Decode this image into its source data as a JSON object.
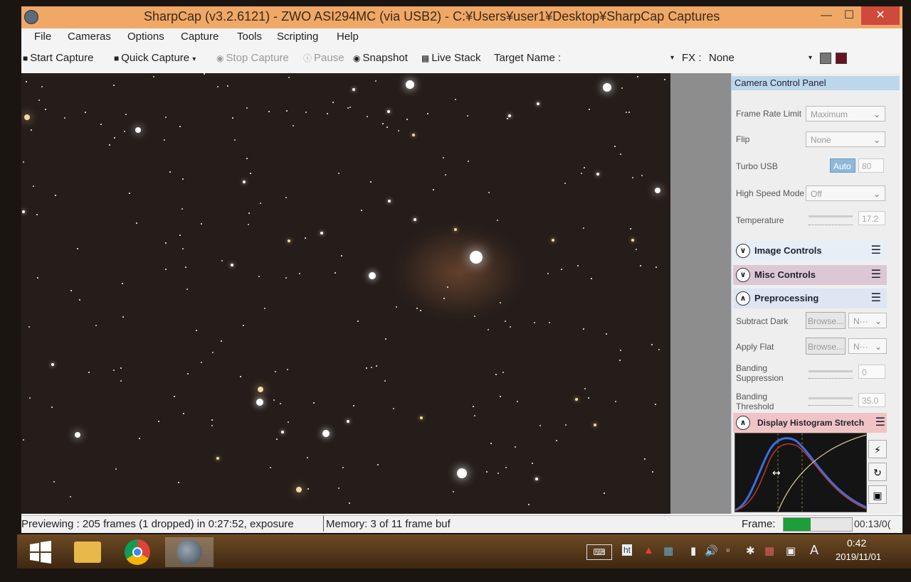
{
  "window": {
    "title": "SharpCap (v3.2.6121) - ZWO ASI294MC (via USB2) - C:¥Users¥user1¥Desktop¥SharpCap Captures",
    "min_label": "—",
    "max_label": "☐",
    "close_label": "✕"
  },
  "menu": [
    "File",
    "Cameras",
    "Options",
    "Capture",
    "Tools",
    "Scripting",
    "Help"
  ],
  "toolbar": {
    "start_capture": "Start Capture",
    "quick_capture": "Quick Capture",
    "stop_capture": "Stop Capture",
    "pause": "Pause",
    "snapshot": "Snapshot",
    "live_stack": "Live Stack",
    "target_name_label": "Target Name :",
    "fx_label": "FX :",
    "fx_value": "None"
  },
  "panel": {
    "title": "Camera Control Panel",
    "frame_rate_limit": {
      "label": "Frame Rate Limit",
      "value": "Maximum"
    },
    "flip": {
      "label": "Flip",
      "value": "None"
    },
    "turbo_usb": {
      "label": "Turbo USB",
      "auto": "Auto",
      "value": "80"
    },
    "high_speed_mode": {
      "label": "High Speed Mode",
      "value": "Off"
    },
    "temperature": {
      "label": "Temperature",
      "value": "17.2"
    },
    "sections": {
      "image_controls": "Image Controls",
      "misc_controls": "Misc Controls",
      "preprocessing": "Preprocessing",
      "histogram_stretch": "Display Histogram Stretch"
    },
    "subtract_dark": {
      "label": "Subtract Dark",
      "browse": "Browse...",
      "value": "N···"
    },
    "apply_flat": {
      "label": "Apply Flat",
      "browse": "Browse...",
      "value": "N···"
    },
    "banding_suppression": {
      "label": "Banding Suppression",
      "value": "0"
    },
    "banding_threshold": {
      "label": "Banding Threshold",
      "value": "35.0"
    }
  },
  "status": {
    "previewing": "Previewing : 205 frames (1 dropped) in 0:27:52, exposure",
    "memory": "Memory: 3 of 11 frame buf",
    "frame_label": "Frame:",
    "frame_progress": 0.4,
    "elapsed": "00:13/0("
  },
  "taskbar": {
    "time": "0:42",
    "date": "2019/11/01",
    "ime": "A"
  },
  "colors": {
    "title_bar": "#f0a867",
    "close_button": "#d04a3c",
    "frame_progress": "#1c9e3a",
    "misc_section": "#dcc8d4",
    "histogram_section": "#f0c4c4"
  }
}
